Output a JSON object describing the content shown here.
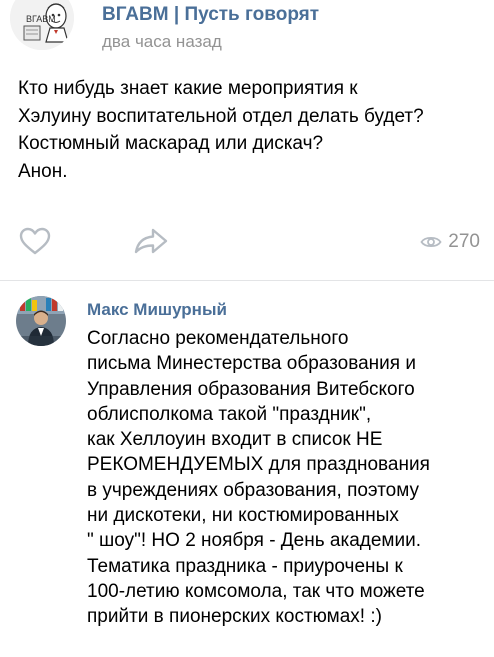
{
  "post": {
    "author": "ВГАВМ | Пусть говорят",
    "time": "два часа назад",
    "avatar_text": "ВГАВМ",
    "text_lines": [
      "Кто нибудь знает какие мероприятия к",
      "Хэлуину воспитательной отдел делать будет?",
      "Костюмный маскарад или дискач?",
      "Анон."
    ],
    "like_icon": "heart-icon",
    "share_icon": "share-arrow-icon",
    "views_icon": "eye-icon",
    "views": "270"
  },
  "comment": {
    "author": "Макс Мишурный",
    "text_lines": [
      "Согласно рекомендательного",
      "письма Минестерства образования и",
      "Управления образования Витебского",
      "облисполкома такой \"праздник\",",
      "как Хеллоуин входит в список НЕ",
      "РЕКОМЕНДУЕМЫХ для празднования",
      "в учреждениях образования, поэтому",
      "ни дискотеки, ни костюмированных",
      "\" шоу\"! НО 2 ноября - День академии.",
      "Тематика праздника - приурочены к",
      "100-летию комсомола, так что можете",
      "прийти в пионерских костюмах! :)"
    ]
  },
  "colors": {
    "author_link": "#4a6f98",
    "secondary_text": "#939393",
    "icon_gray": "#b6bcc3",
    "divider": "#e3e4e6"
  }
}
